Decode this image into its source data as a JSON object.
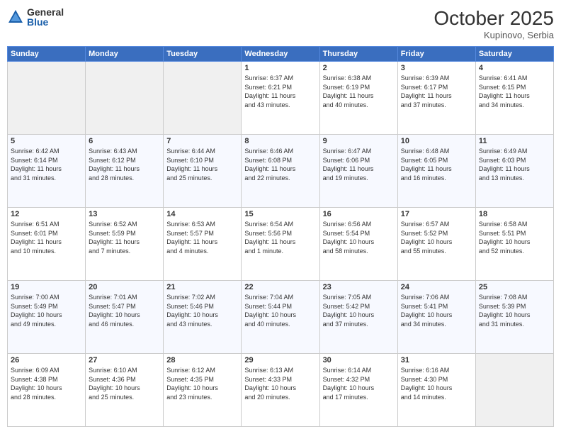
{
  "header": {
    "logo_general": "General",
    "logo_blue": "Blue",
    "month_title": "October 2025",
    "subtitle": "Kupinovo, Serbia"
  },
  "days_of_week": [
    "Sunday",
    "Monday",
    "Tuesday",
    "Wednesday",
    "Thursday",
    "Friday",
    "Saturday"
  ],
  "weeks": [
    [
      {
        "day": "",
        "info": ""
      },
      {
        "day": "",
        "info": ""
      },
      {
        "day": "",
        "info": ""
      },
      {
        "day": "1",
        "info": "Sunrise: 6:37 AM\nSunset: 6:21 PM\nDaylight: 11 hours\nand 43 minutes."
      },
      {
        "day": "2",
        "info": "Sunrise: 6:38 AM\nSunset: 6:19 PM\nDaylight: 11 hours\nand 40 minutes."
      },
      {
        "day": "3",
        "info": "Sunrise: 6:39 AM\nSunset: 6:17 PM\nDaylight: 11 hours\nand 37 minutes."
      },
      {
        "day": "4",
        "info": "Sunrise: 6:41 AM\nSunset: 6:15 PM\nDaylight: 11 hours\nand 34 minutes."
      }
    ],
    [
      {
        "day": "5",
        "info": "Sunrise: 6:42 AM\nSunset: 6:14 PM\nDaylight: 11 hours\nand 31 minutes."
      },
      {
        "day": "6",
        "info": "Sunrise: 6:43 AM\nSunset: 6:12 PM\nDaylight: 11 hours\nand 28 minutes."
      },
      {
        "day": "7",
        "info": "Sunrise: 6:44 AM\nSunset: 6:10 PM\nDaylight: 11 hours\nand 25 minutes."
      },
      {
        "day": "8",
        "info": "Sunrise: 6:46 AM\nSunset: 6:08 PM\nDaylight: 11 hours\nand 22 minutes."
      },
      {
        "day": "9",
        "info": "Sunrise: 6:47 AM\nSunset: 6:06 PM\nDaylight: 11 hours\nand 19 minutes."
      },
      {
        "day": "10",
        "info": "Sunrise: 6:48 AM\nSunset: 6:05 PM\nDaylight: 11 hours\nand 16 minutes."
      },
      {
        "day": "11",
        "info": "Sunrise: 6:49 AM\nSunset: 6:03 PM\nDaylight: 11 hours\nand 13 minutes."
      }
    ],
    [
      {
        "day": "12",
        "info": "Sunrise: 6:51 AM\nSunset: 6:01 PM\nDaylight: 11 hours\nand 10 minutes."
      },
      {
        "day": "13",
        "info": "Sunrise: 6:52 AM\nSunset: 5:59 PM\nDaylight: 11 hours\nand 7 minutes."
      },
      {
        "day": "14",
        "info": "Sunrise: 6:53 AM\nSunset: 5:57 PM\nDaylight: 11 hours\nand 4 minutes."
      },
      {
        "day": "15",
        "info": "Sunrise: 6:54 AM\nSunset: 5:56 PM\nDaylight: 11 hours\nand 1 minute."
      },
      {
        "day": "16",
        "info": "Sunrise: 6:56 AM\nSunset: 5:54 PM\nDaylight: 10 hours\nand 58 minutes."
      },
      {
        "day": "17",
        "info": "Sunrise: 6:57 AM\nSunset: 5:52 PM\nDaylight: 10 hours\nand 55 minutes."
      },
      {
        "day": "18",
        "info": "Sunrise: 6:58 AM\nSunset: 5:51 PM\nDaylight: 10 hours\nand 52 minutes."
      }
    ],
    [
      {
        "day": "19",
        "info": "Sunrise: 7:00 AM\nSunset: 5:49 PM\nDaylight: 10 hours\nand 49 minutes."
      },
      {
        "day": "20",
        "info": "Sunrise: 7:01 AM\nSunset: 5:47 PM\nDaylight: 10 hours\nand 46 minutes."
      },
      {
        "day": "21",
        "info": "Sunrise: 7:02 AM\nSunset: 5:46 PM\nDaylight: 10 hours\nand 43 minutes."
      },
      {
        "day": "22",
        "info": "Sunrise: 7:04 AM\nSunset: 5:44 PM\nDaylight: 10 hours\nand 40 minutes."
      },
      {
        "day": "23",
        "info": "Sunrise: 7:05 AM\nSunset: 5:42 PM\nDaylight: 10 hours\nand 37 minutes."
      },
      {
        "day": "24",
        "info": "Sunrise: 7:06 AM\nSunset: 5:41 PM\nDaylight: 10 hours\nand 34 minutes."
      },
      {
        "day": "25",
        "info": "Sunrise: 7:08 AM\nSunset: 5:39 PM\nDaylight: 10 hours\nand 31 minutes."
      }
    ],
    [
      {
        "day": "26",
        "info": "Sunrise: 6:09 AM\nSunset: 4:38 PM\nDaylight: 10 hours\nand 28 minutes."
      },
      {
        "day": "27",
        "info": "Sunrise: 6:10 AM\nSunset: 4:36 PM\nDaylight: 10 hours\nand 25 minutes."
      },
      {
        "day": "28",
        "info": "Sunrise: 6:12 AM\nSunset: 4:35 PM\nDaylight: 10 hours\nand 23 minutes."
      },
      {
        "day": "29",
        "info": "Sunrise: 6:13 AM\nSunset: 4:33 PM\nDaylight: 10 hours\nand 20 minutes."
      },
      {
        "day": "30",
        "info": "Sunrise: 6:14 AM\nSunset: 4:32 PM\nDaylight: 10 hours\nand 17 minutes."
      },
      {
        "day": "31",
        "info": "Sunrise: 6:16 AM\nSunset: 4:30 PM\nDaylight: 10 hours\nand 14 minutes."
      },
      {
        "day": "",
        "info": ""
      }
    ]
  ]
}
